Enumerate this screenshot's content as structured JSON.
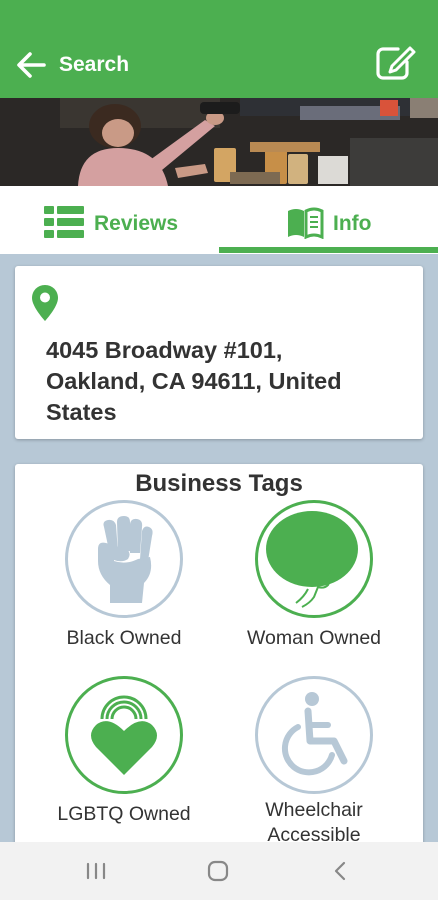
{
  "header": {
    "back_label": "Search"
  },
  "tabs": [
    {
      "label": "Reviews",
      "active": false
    },
    {
      "label": "Info",
      "active": true
    }
  ],
  "address": {
    "line1": "4045 Broadway #101,",
    "line2": "Oakland, CA 94611, United",
    "line3": "States"
  },
  "business_tags": {
    "title": "Business Tags",
    "items": [
      {
        "label": "Black Owned",
        "icon": "raised-fist-icon"
      },
      {
        "label": "Woman Owned",
        "icon": "woman-profile-icon"
      },
      {
        "label": "LGBTQ Owned",
        "icon": "rainbow-heart-icon"
      },
      {
        "label_line1": "Wheelchair",
        "label_line2": "Accessible",
        "icon": "wheelchair-icon"
      }
    ]
  },
  "colors": {
    "accent": "#4caf50",
    "inactive_tag": "#b7c8d6",
    "background": "#b7c8d6"
  }
}
